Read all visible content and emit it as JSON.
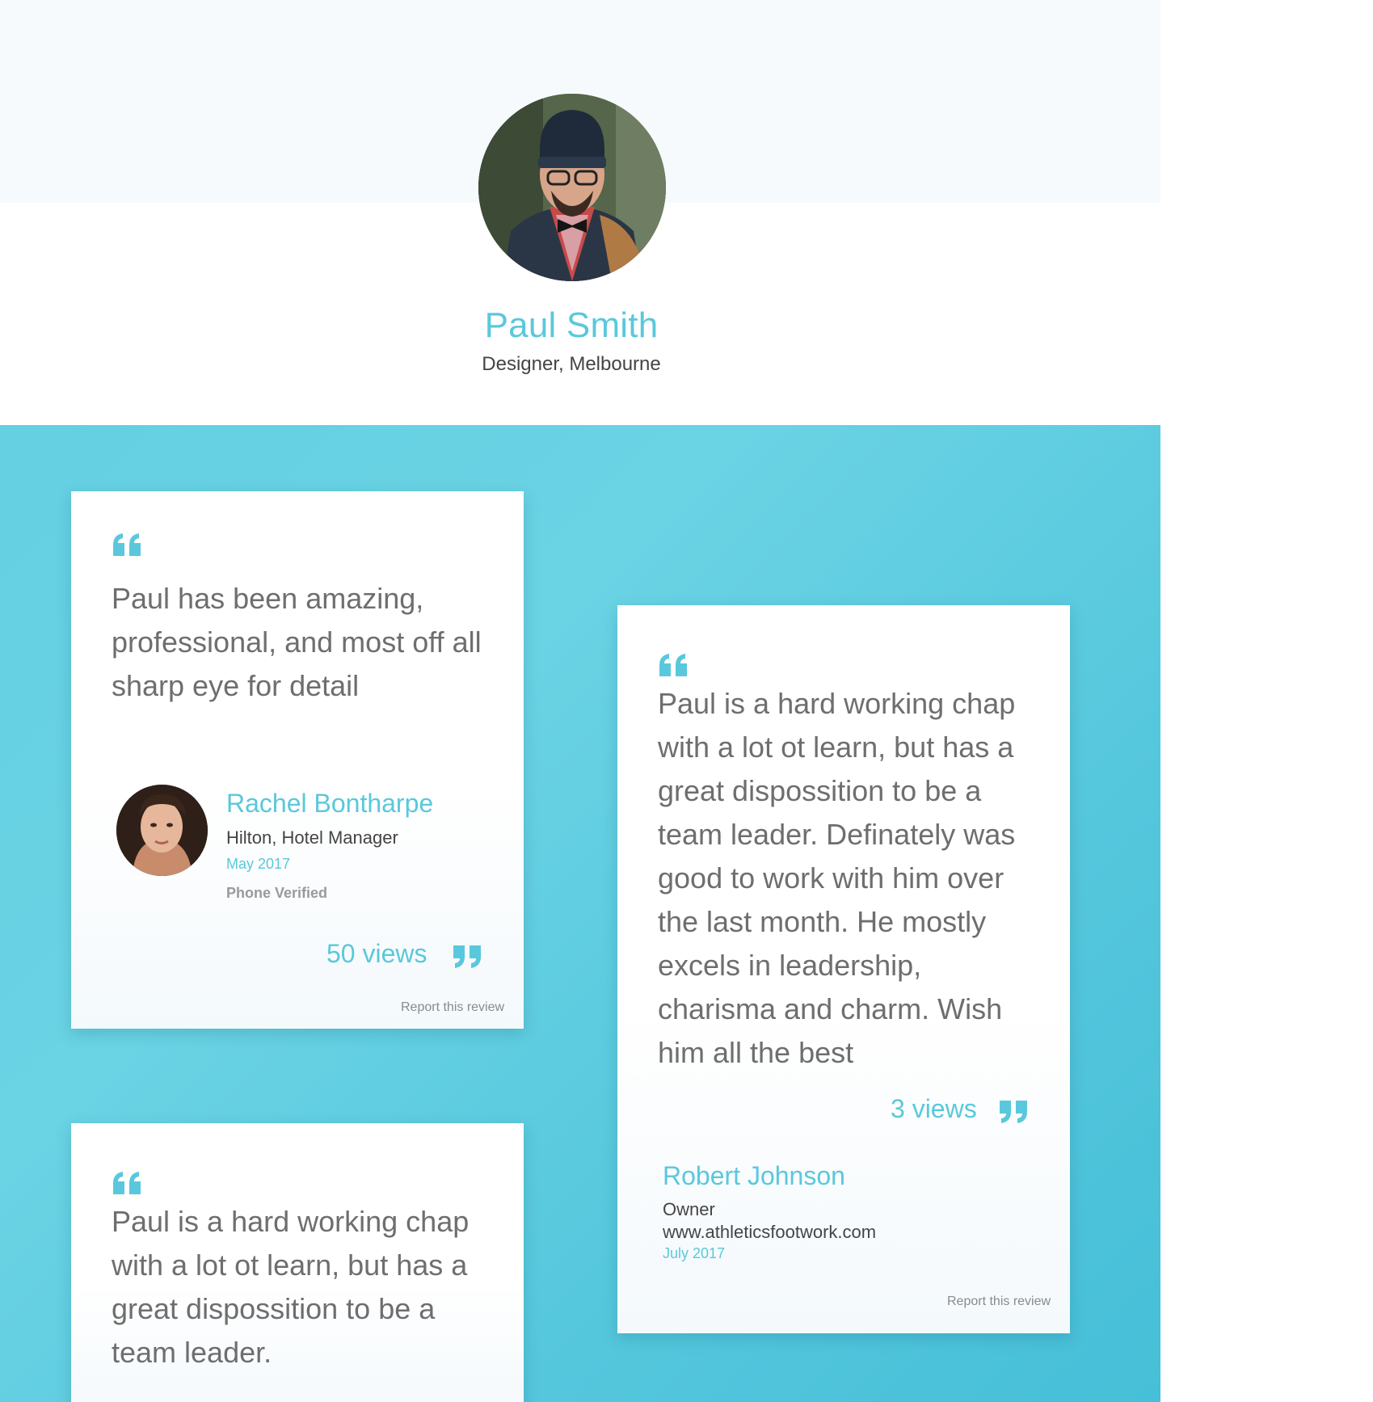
{
  "profile": {
    "name": "Paul Smith",
    "subtitle": "Designer, Melbourne"
  },
  "reviews": [
    {
      "text_lines": [
        "Paul has been amazing,",
        "professional, and most off all",
        "sharp eye for detail"
      ],
      "reviewer": {
        "name": "Rachel Bontharpe",
        "role": "Hilton, Hotel Manager",
        "date": "May 2017",
        "verified": "Phone Verified"
      },
      "views": "50 views",
      "report": "Report this review"
    },
    {
      "text_lines": [
        "Paul is a hard working chap",
        "with a lot ot learn, but has a",
        "great dispossition to be a",
        "team leader. Definately was",
        "good to work with him over",
        "the last month. He mostly",
        "excels in leadership,",
        "charisma and charm. Wish",
        "him all the best"
      ],
      "reviewer": {
        "name": "Robert Johnson",
        "role": "Owner",
        "website": "www.athleticsfootwork.com",
        "date": "July 2017"
      },
      "views": "3 views",
      "report": "Report this review"
    },
    {
      "text_lines": [
        "Paul is a hard working chap",
        "with a lot ot learn, but has a",
        "great dispossition to be a",
        "team leader."
      ]
    }
  ],
  "colors": {
    "accent": "#5ac8dc",
    "band": "#f7fafd",
    "reviews_bg": "#5ccbe0"
  }
}
